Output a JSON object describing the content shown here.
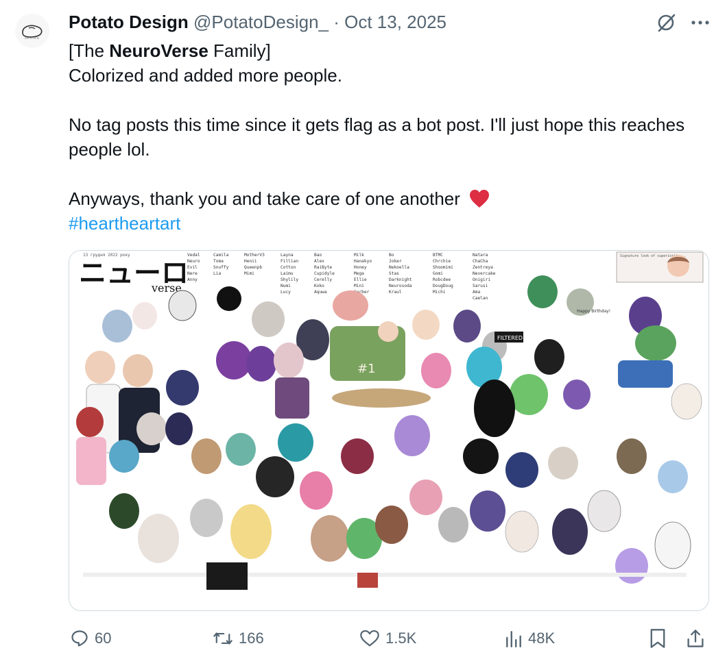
{
  "post": {
    "author_name": "Potato Design",
    "author_handle": "@PotatoDesign_",
    "separator": "·",
    "date": "Oct 13, 2025",
    "avatar_wordmark": "DESIGN",
    "lines": {
      "l1_open": "[The ",
      "l1_bold": "NeuroVerse",
      "l1_close": " Family]",
      "l2": "Colorized and added more people.",
      "l3": "No tag posts this time since it gets flag as a bot post. I'll just hope this reaches people lol.",
      "l4": "Anyways, thank you and take care of one another",
      "hashtag": "#heartheartart"
    },
    "emoji": "red-heart-emoji"
  },
  "media": {
    "logo_text": "ニューロ",
    "logo_sub": "verse.",
    "caption_small": "13 грудня 2022 року",
    "sign_note": "Signature look of superiority...",
    "sign_pets": "Happy Birthday!",
    "sign_filtered": "FILTERED",
    "shirt_text": "#1",
    "name_columns": [
      [
        "Vedal",
        "Neuro",
        "Evil",
        "Nere",
        "Anny"
      ],
      [
        "Camila",
        "Toma",
        "Snuffy",
        "Lia"
      ],
      [
        "MotherV3",
        "Henii",
        "Queenpb",
        "Mimi"
      ],
      [
        "Layna",
        "Fillian",
        "Cotton",
        "Laimu",
        "Shylily",
        "Numi",
        "Lucy"
      ],
      [
        "Bao",
        "Alex",
        "RaiByte",
        "Cupidyle",
        "Cerelly",
        "Koko",
        "Aquwa"
      ],
      [
        "Milk",
        "Hanakyo",
        "Honey",
        "Mega",
        "Ellie",
        "Mini",
        "Cerber"
      ],
      [
        "Bo",
        "Joker",
        "Nekoella",
        "Stas",
        "Darknight",
        "Neurosoda",
        "Kraul"
      ],
      [
        "BTMC",
        "Chrchie",
        "Shoomimi",
        "Gomi",
        "Robcdee",
        "DougDoug",
        "Michi"
      ],
      [
        "Natara",
        "ChaCha",
        "Zentreya",
        "Nevercake",
        "Onigiri",
        "Sarusi",
        "Ama",
        "Caelan"
      ]
    ]
  },
  "actions": {
    "replies": "60",
    "reposts": "166",
    "likes": "1.5K",
    "views": "48K"
  },
  "colors": {
    "text": "#0f1419",
    "muted": "#536471",
    "link": "#1d9bf0",
    "heart": "#e0245e",
    "border": "#cfd9de"
  }
}
